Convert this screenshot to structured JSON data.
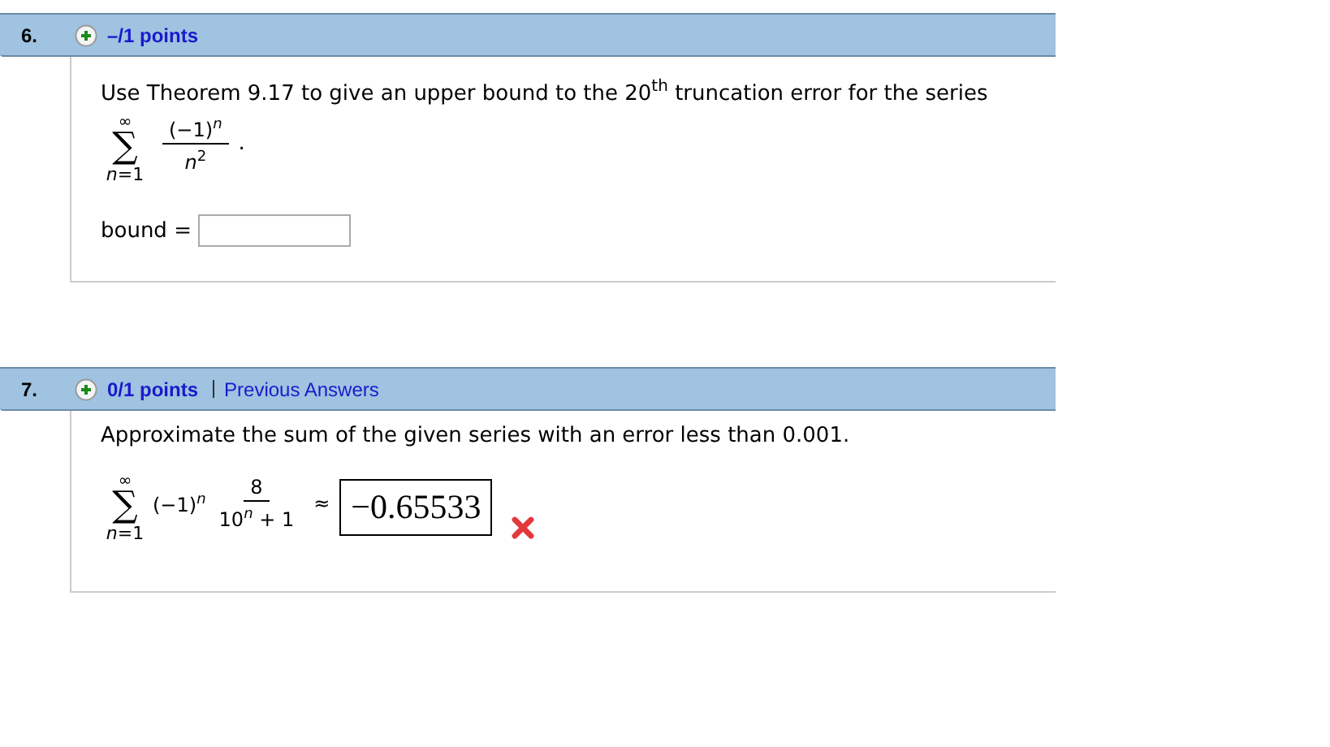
{
  "questions": [
    {
      "number": "6.",
      "points": "–/1 points",
      "prompt": "Use Theorem 9.17 to give an upper bound to the 20$^{th}$ truncation error for the series",
      "kind": "fill",
      "series": {
        "upper": "∞",
        "symbol": "∑",
        "lower": "*n*=1",
        "numerator": "(−1)$^{n}$",
        "denominator": "*n*$^{2}$",
        "trailing": "."
      },
      "answer": {
        "label": "bound ="
      }
    },
    {
      "number": "7.",
      "points": "0/1 points",
      "link": "Previous Answers",
      "prompt": "Approximate the sum of the given series with an error less than 0.001.",
      "kind": "equation",
      "series": {
        "upper": "∞",
        "symbol": "∑",
        "lower": "*n*=1",
        "factor": "(−1)$^{n}$",
        "numerator": "8",
        "denominator": "10$^{n}$ + 1",
        "relation": "≈"
      },
      "answer": {
        "value": "−0.65533",
        "correct": false
      }
    }
  ]
}
